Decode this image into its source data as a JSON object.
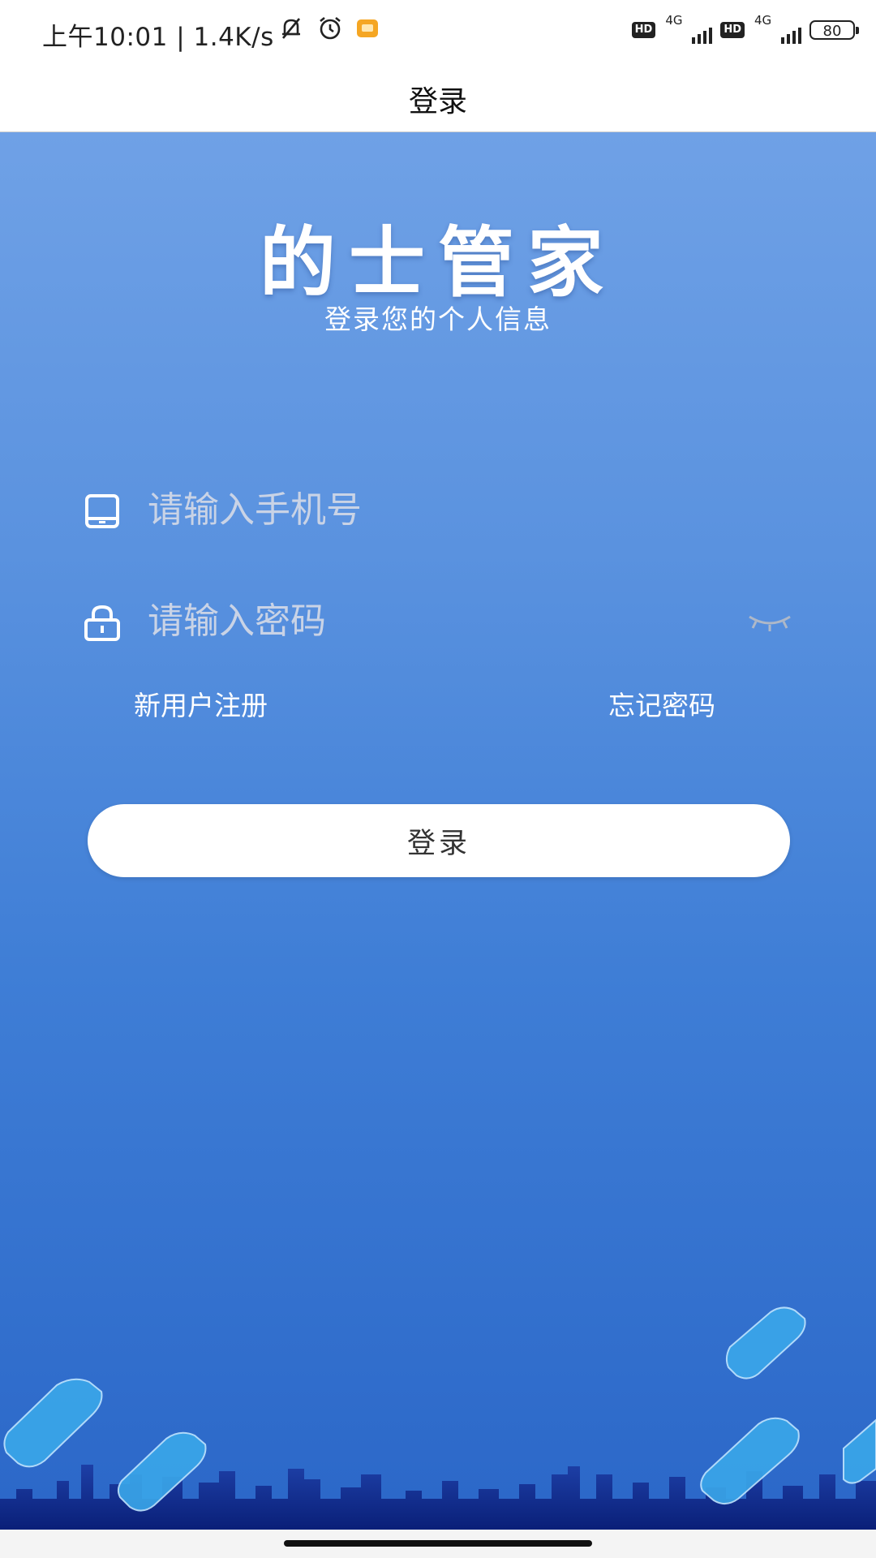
{
  "status_bar": {
    "time": "上午10:01",
    "speed": "1.4K/s",
    "network1": "4G",
    "network2": "4G",
    "hd": "HD",
    "battery": "80"
  },
  "header": {
    "title": "登录"
  },
  "brand": {
    "name": "的士管家",
    "subtitle": "登录您的个人信息"
  },
  "form": {
    "phone_placeholder": "请输入手机号",
    "password_placeholder": "请输入密码",
    "register_link": "新用户注册",
    "forgot_link": "忘记密码",
    "login_button": "登录"
  },
  "colors": {
    "bg_top": "#6fa1e6",
    "bg_bottom": "#2b67c8",
    "skyline": "#0b2a8c",
    "car": "#3aa7ea"
  }
}
